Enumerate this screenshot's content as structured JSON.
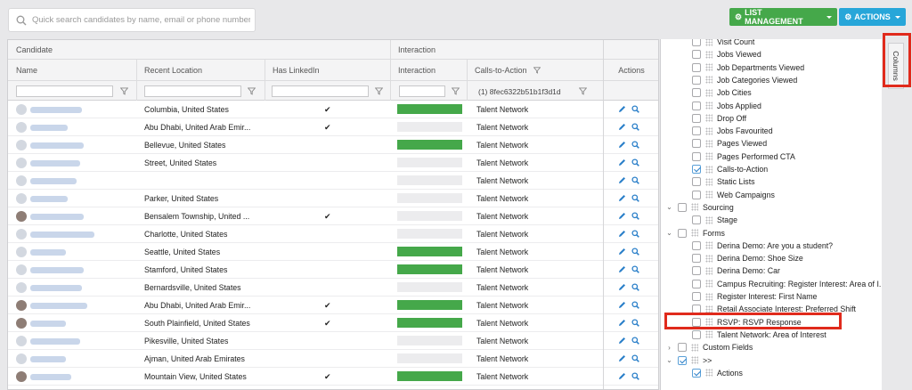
{
  "search": {
    "placeholder": "Quick search candidates by name, email or phone number"
  },
  "toolbar": {
    "list_management": "LIST MANAGEMENT",
    "actions": "ACTIONS"
  },
  "colors": {
    "green": "#45a84a",
    "blue": "#27a6d9",
    "highlight": "#e02a1c"
  },
  "grid": {
    "group_candidate": "Candidate",
    "group_interaction": "Interaction",
    "col_name": "Name",
    "col_location": "Recent Location",
    "col_linkedin": "Has LinkedIn",
    "col_interaction": "Interaction",
    "col_cta": "Calls-to-Action",
    "col_actions": "Actions",
    "cta_filter_value": "(1) 8fec6322b51b1f3d1d",
    "rows": [
      {
        "location": "Columbia, United States",
        "linkedin": "✔",
        "interaction": 1,
        "cta": "Talent Network"
      },
      {
        "location": "Abu Dhabi, United Arab Emir...",
        "linkedin": "✔",
        "interaction": 0,
        "cta": "Talent Network"
      },
      {
        "location": "Bellevue, United States",
        "linkedin": "",
        "interaction": 1,
        "cta": "Talent Network"
      },
      {
        "location": "Street, United States",
        "linkedin": "",
        "interaction": 0,
        "cta": "Talent Network"
      },
      {
        "location": "",
        "linkedin": "",
        "interaction": 0,
        "cta": "Talent Network"
      },
      {
        "location": "Parker, United States",
        "linkedin": "",
        "interaction": 0,
        "cta": "Talent Network"
      },
      {
        "location": "Bensalem Township, United ...",
        "linkedin": "✔",
        "interaction": 0,
        "cta": "Talent Network"
      },
      {
        "location": "Charlotte, United States",
        "linkedin": "",
        "interaction": 0,
        "cta": "Talent Network"
      },
      {
        "location": "Seattle, United States",
        "linkedin": "",
        "interaction": 1,
        "cta": "Talent Network"
      },
      {
        "location": "Stamford, United States",
        "linkedin": "",
        "interaction": 1,
        "cta": "Talent Network"
      },
      {
        "location": "Bernardsville, United States",
        "linkedin": "",
        "interaction": 0,
        "cta": "Talent Network"
      },
      {
        "location": "Abu Dhabi, United Arab Emir...",
        "linkedin": "✔",
        "interaction": 1,
        "cta": "Talent Network"
      },
      {
        "location": "South Plainfield, United States",
        "linkedin": "✔",
        "interaction": 1,
        "cta": "Talent Network"
      },
      {
        "location": "Pikesville, United States",
        "linkedin": "",
        "interaction": 0,
        "cta": "Talent Network"
      },
      {
        "location": "Ajman, United Arab Emirates",
        "linkedin": "",
        "interaction": 0,
        "cta": "Talent Network"
      },
      {
        "location": "Mountain View, United States",
        "linkedin": "✔",
        "interaction": 1,
        "cta": "Talent Network"
      }
    ]
  },
  "columns_panel": {
    "tab_label": "Columns",
    "items": [
      {
        "label": "Visit Count",
        "checked": false,
        "level": 2
      },
      {
        "label": "Jobs Viewed",
        "checked": false,
        "level": 2
      },
      {
        "label": "Job Departments Viewed",
        "checked": false,
        "level": 2
      },
      {
        "label": "Job Categories Viewed",
        "checked": false,
        "level": 2
      },
      {
        "label": "Job Cities",
        "checked": false,
        "level": 2
      },
      {
        "label": "Jobs Applied",
        "checked": false,
        "level": 2
      },
      {
        "label": "Drop Off",
        "checked": false,
        "level": 2
      },
      {
        "label": "Jobs Favourited",
        "checked": false,
        "level": 2
      },
      {
        "label": "Pages Viewed",
        "checked": false,
        "level": 2
      },
      {
        "label": "Pages Performed CTA",
        "checked": false,
        "level": 2
      },
      {
        "label": "Calls-to-Action",
        "checked": true,
        "level": 2
      },
      {
        "label": "Static Lists",
        "checked": false,
        "level": 2
      },
      {
        "label": "Web Campaigns",
        "checked": false,
        "level": 2
      },
      {
        "label": "Sourcing",
        "checked": false,
        "level": 1,
        "toggle": "⌄"
      },
      {
        "label": "Stage",
        "checked": false,
        "level": 2
      },
      {
        "label": "Forms",
        "checked": false,
        "level": 1,
        "toggle": "⌄"
      },
      {
        "label": "Derina Demo: Are you a student?",
        "checked": false,
        "level": 2
      },
      {
        "label": "Derina Demo: Shoe Size",
        "checked": false,
        "level": 2
      },
      {
        "label": "Derina Demo: Car",
        "checked": false,
        "level": 2
      },
      {
        "label": "Campus Recruiting: Register Interest: Area of I...",
        "checked": false,
        "level": 2
      },
      {
        "label": "Register Interest: First Name",
        "checked": false,
        "level": 2
      },
      {
        "label": "Retail Associate Interest: Preferred Shift",
        "checked": false,
        "level": 2
      },
      {
        "label": "RSVP: RSVP Response",
        "checked": false,
        "level": 2
      },
      {
        "label": "Talent Network: Area of Interest",
        "checked": false,
        "level": 2
      },
      {
        "label": "Custom Fields",
        "checked": false,
        "level": 1,
        "toggle": "›"
      },
      {
        "label": ">>",
        "checked": true,
        "level": 1,
        "toggle": "⌄"
      },
      {
        "label": "Actions",
        "checked": true,
        "level": 2
      }
    ]
  }
}
